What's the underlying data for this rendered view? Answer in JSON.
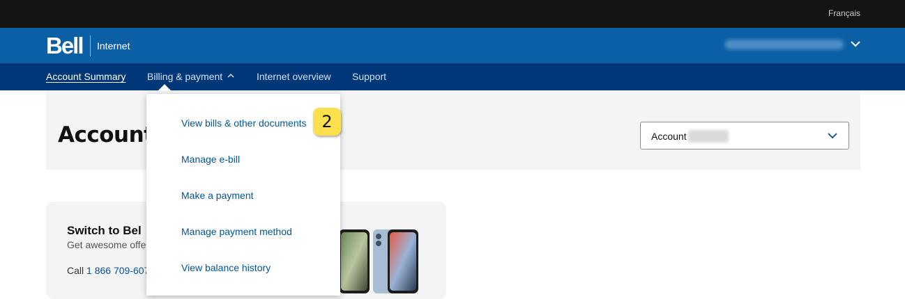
{
  "topbar": {
    "language_link": "Français"
  },
  "header": {
    "logo": "Bell",
    "product": "Internet",
    "account_email": ""
  },
  "nav": {
    "items": [
      {
        "label": "Account Summary",
        "active": true
      },
      {
        "label": "Billing & payment",
        "expanded": true
      },
      {
        "label": "Internet overview"
      },
      {
        "label": "Support"
      }
    ]
  },
  "hero": {
    "title": "Account",
    "account_select_label": "Account"
  },
  "billing_menu": {
    "items": [
      "View bills & other documents",
      "Manage e-bill",
      "Make a payment",
      "Manage payment method",
      "View balance history"
    ]
  },
  "step_badge": "2",
  "promo": {
    "title": "Switch to Bel",
    "subtitle": "Get awesome offe",
    "call_prefix": "Call ",
    "phone": "1 866 709-607"
  },
  "colors": {
    "topbar": "#141414",
    "header_blue": "#0b5fa5",
    "nav_navy": "#003778",
    "link_blue": "#00549a",
    "badge_yellow": "#fde04e"
  }
}
